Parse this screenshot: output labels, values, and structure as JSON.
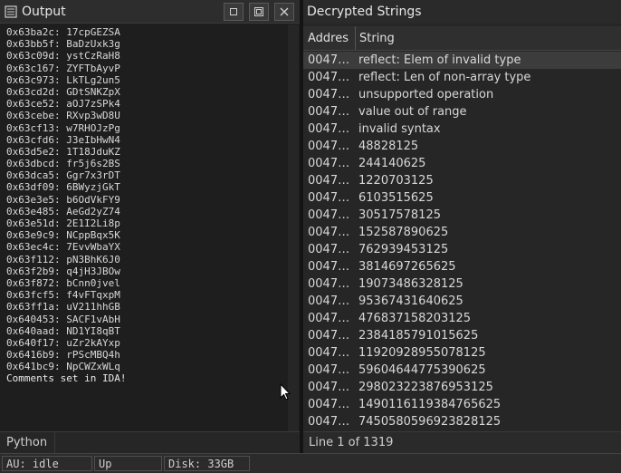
{
  "output_panel": {
    "title": "Output",
    "lines": [
      {
        "addr": "0x63ba2c:",
        "val": "17cpGEZSA"
      },
      {
        "addr": "0x63bb5f:",
        "val": "BaDzUxk3g"
      },
      {
        "addr": "0x63c09d:",
        "val": "ystCzRaH8"
      },
      {
        "addr": "0x63c167:",
        "val": "ZYFTbAyvP"
      },
      {
        "addr": "0x63c973:",
        "val": "LkTLg2un5"
      },
      {
        "addr": "0x63cd2d:",
        "val": "GDtSNKZpX"
      },
      {
        "addr": "0x63ce52:",
        "val": "aOJ7zSPk4"
      },
      {
        "addr": "0x63cebe:",
        "val": "RXvp3wD8U"
      },
      {
        "addr": "0x63cf13:",
        "val": "w7RHOJzPg"
      },
      {
        "addr": "0x63cfd6:",
        "val": "J3eIbHwN4"
      },
      {
        "addr": "0x63d5e2:",
        "val": "1T18JduKZ"
      },
      {
        "addr": "0x63dbcd:",
        "val": "fr5j6s2BS"
      },
      {
        "addr": "0x63dca5:",
        "val": "Ggr7x3rDT"
      },
      {
        "addr": "0x63df09:",
        "val": "6BWyzjGkT"
      },
      {
        "addr": "0x63e3e5:",
        "val": "b6OdVkFY9"
      },
      {
        "addr": "0x63e485:",
        "val": "AeGd2yZ74"
      },
      {
        "addr": "0x63e51d:",
        "val": "2E1I2Li8p"
      },
      {
        "addr": "0x63e9c9:",
        "val": "NCppBqx5K"
      },
      {
        "addr": "0x63ec4c:",
        "val": "7EvvWbaYX"
      },
      {
        "addr": "0x63f112:",
        "val": "pN3BhK6J0"
      },
      {
        "addr": "0x63f2b9:",
        "val": "q4jH3JBOw"
      },
      {
        "addr": "0x63f872:",
        "val": "bCnn0jvel"
      },
      {
        "addr": "0x63fcf5:",
        "val": "f4vFTqxpM"
      },
      {
        "addr": "0x63ff1a:",
        "val": "uV211hhGB"
      },
      {
        "addr": "0x640453:",
        "val": "SACF1vAbH"
      },
      {
        "addr": "0x640aad:",
        "val": "ND1YI8qBT"
      },
      {
        "addr": "0x640f17:",
        "val": "uZr2kAYxp"
      },
      {
        "addr": "0x6416b9:",
        "val": "rPScMBQ4h"
      },
      {
        "addr": "0x641bc9:",
        "val": "NpCWZxWLq"
      }
    ],
    "final_line": "Comments set in IDA!",
    "python_label": "Python"
  },
  "strings_panel": {
    "title": "Decrypted Strings",
    "col_address": "Addres",
    "col_string": "String",
    "rows": [
      {
        "addr": "0047…",
        "str": "reflect: Elem of invalid type"
      },
      {
        "addr": "0047…",
        "str": "reflect: Len of non-array type"
      },
      {
        "addr": "0047…",
        "str": "unsupported operation"
      },
      {
        "addr": "0047…",
        "str": "value out of range"
      },
      {
        "addr": "0047…",
        "str": "invalid syntax"
      },
      {
        "addr": "0047…",
        "str": "48828125"
      },
      {
        "addr": "0047…",
        "str": "244140625"
      },
      {
        "addr": "0047…",
        "str": "1220703125"
      },
      {
        "addr": "0047…",
        "str": "6103515625"
      },
      {
        "addr": "0047…",
        "str": "30517578125"
      },
      {
        "addr": "0047…",
        "str": "152587890625"
      },
      {
        "addr": "0047…",
        "str": "762939453125"
      },
      {
        "addr": "0047…",
        "str": "3814697265625"
      },
      {
        "addr": "0047…",
        "str": "19073486328125"
      },
      {
        "addr": "0047…",
        "str": "95367431640625"
      },
      {
        "addr": "0047…",
        "str": "476837158203125"
      },
      {
        "addr": "0047…",
        "str": "2384185791015625"
      },
      {
        "addr": "0047…",
        "str": "11920928955078125"
      },
      {
        "addr": "0047…",
        "str": "59604644775390625"
      },
      {
        "addr": "0047…",
        "str": "298023223876953125"
      },
      {
        "addr": "0047…",
        "str": "1490116119384765625"
      },
      {
        "addr": "0047…",
        "str": "7450580596923828125"
      }
    ],
    "status": "Line 1 of 1319"
  },
  "statusbar": {
    "au": "AU:  idle",
    "direction": "Up",
    "disk": "Disk: 33GB"
  },
  "icons": {
    "output": "output-window-icon",
    "restore": "restore-icon",
    "float": "float-icon",
    "close": "close-icon"
  }
}
